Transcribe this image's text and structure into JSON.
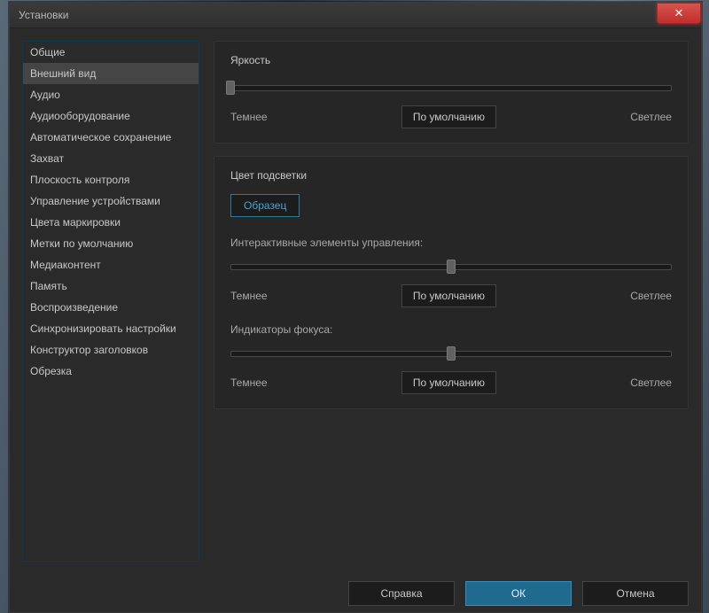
{
  "window": {
    "title": "Установки"
  },
  "close": "✕",
  "sidebar": {
    "items": [
      {
        "label": "Общие"
      },
      {
        "label": "Внешний вид"
      },
      {
        "label": "Аудио"
      },
      {
        "label": "Аудиооборудование"
      },
      {
        "label": "Автоматическое сохранение"
      },
      {
        "label": "Захват"
      },
      {
        "label": "Плоскость контроля"
      },
      {
        "label": "Управление устройствами"
      },
      {
        "label": "Цвета маркировки"
      },
      {
        "label": "Метки по умолчанию"
      },
      {
        "label": "Медиаконтент"
      },
      {
        "label": "Память"
      },
      {
        "label": "Воспроизведение"
      },
      {
        "label": "Синхронизировать настройки"
      },
      {
        "label": "Конструктор заголовков"
      },
      {
        "label": "Обрезка"
      }
    ],
    "active_index": 1
  },
  "brightness": {
    "title": "Яркость",
    "left": "Темнее",
    "default": "По умолчанию",
    "right": "Светлее",
    "position_pct": 0
  },
  "highlight": {
    "title": "Цвет подсветки",
    "sample": "Образец",
    "controls_label": "Интерактивные элементы управления:",
    "focus_label": "Индикаторы фокуса:",
    "left": "Темнее",
    "default": "По умолчанию",
    "right": "Светлее",
    "controls_position_pct": 50,
    "focus_position_pct": 50
  },
  "footer": {
    "help": "Справка",
    "ok": "ОК",
    "cancel": "Отмена"
  }
}
